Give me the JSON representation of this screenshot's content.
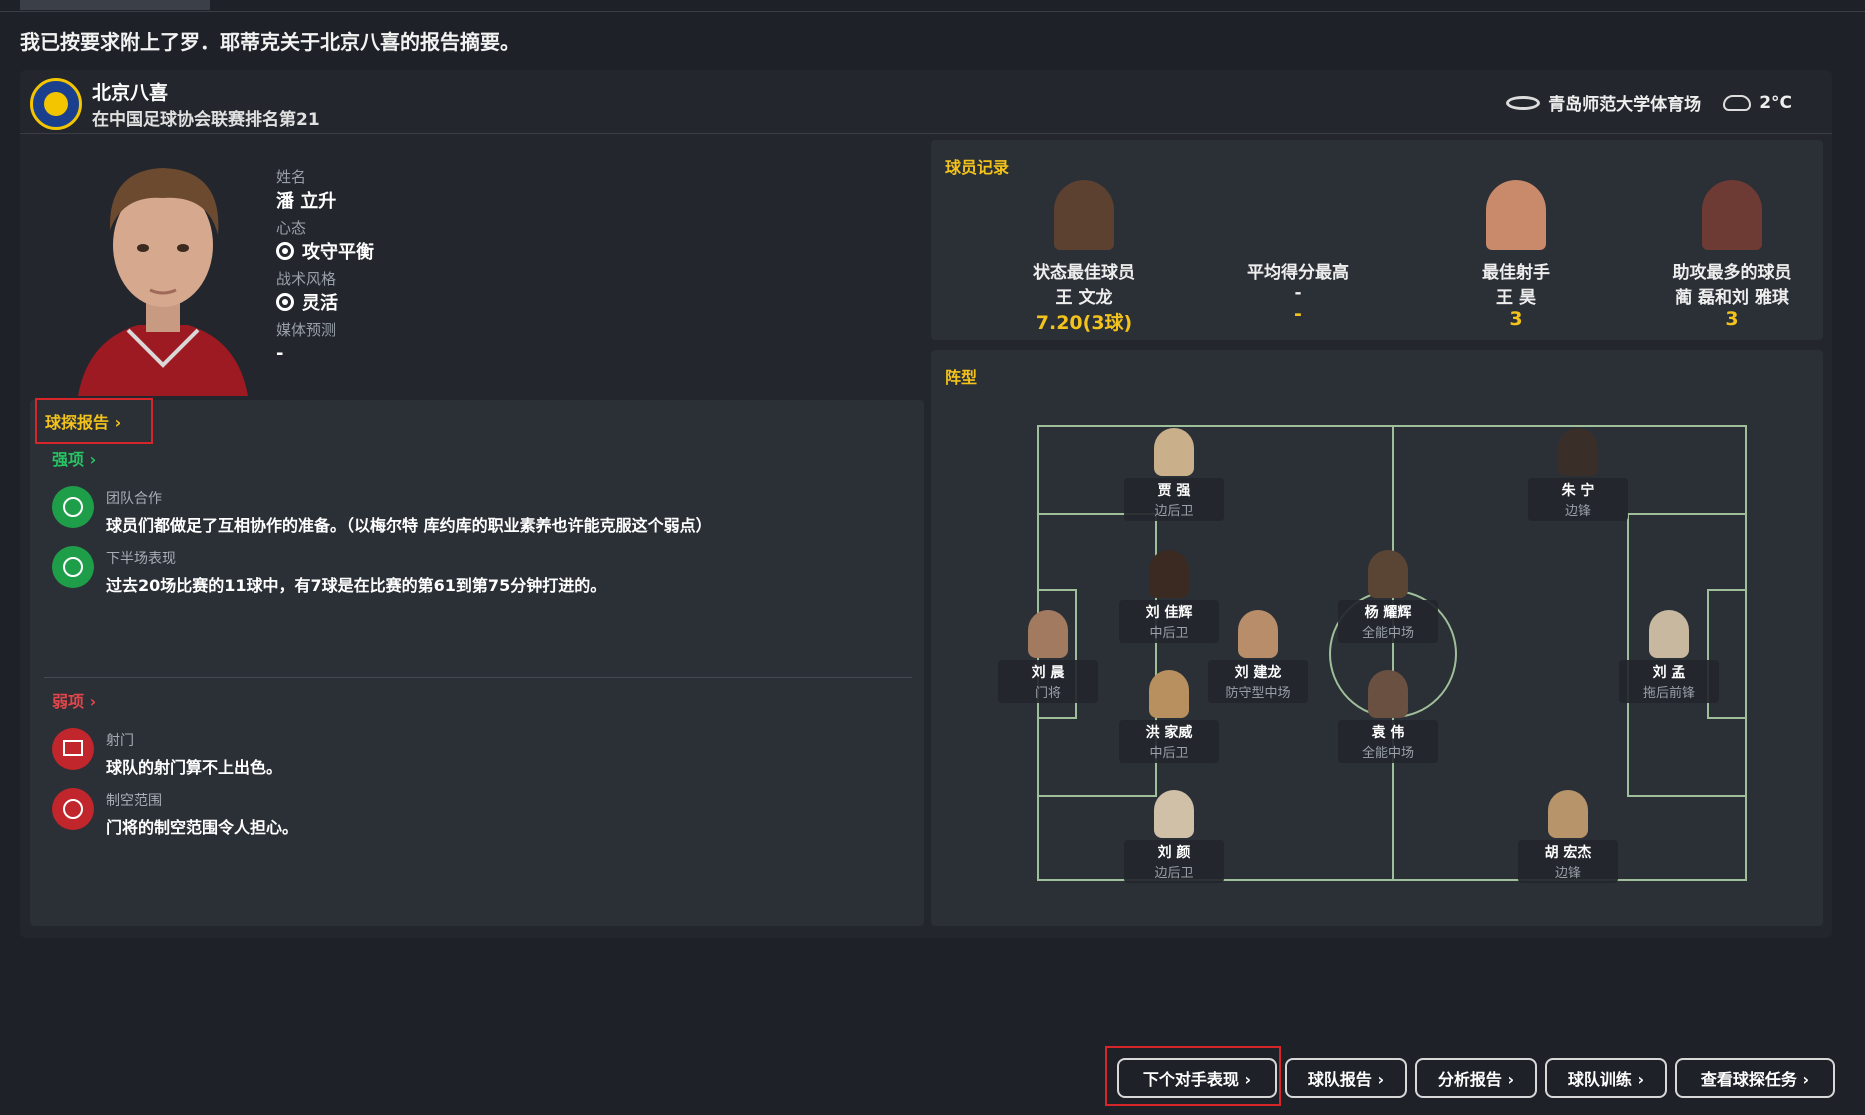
{
  "message": "我已按要求附上了罗．耶蒂克关于北京八喜的报告摘要。",
  "club": {
    "name": "北京八喜",
    "ranking": "在中国足球协会联赛排名第21",
    "venue": "青岛师范大学体育场",
    "temperature": "2°C"
  },
  "player": {
    "name_label": "姓名",
    "name": "潘 立升",
    "mentality_label": "心态",
    "mentality": "攻守平衡",
    "style_label": "战术风格",
    "style": "灵活",
    "media_label": "媒体预测",
    "media": "-"
  },
  "scout": {
    "tab_label": "球探报告 ›",
    "strengths_title": "强项 ›",
    "strengths": [
      {
        "title": "团队合作",
        "text": "球员们都做足了互相协作的准备。（以梅尔特 库约库的职业素养也许能克服这个弱点）"
      },
      {
        "title": "下半场表现",
        "text": "过去20场比赛的11球中，有7球是在比赛的第61到第75分钟打进的。"
      }
    ],
    "weaknesses_title": "弱项 ›",
    "weaknesses": [
      {
        "title": "射门",
        "text": "球队的射门算不上出色。"
      },
      {
        "title": "制空范围",
        "text": "门将的制空范围令人担心。"
      }
    ]
  },
  "records": {
    "title": "球员记录",
    "items": [
      {
        "label": "状态最佳球员",
        "name": "王 文龙",
        "value": "7.20(3球)"
      },
      {
        "label": "平均得分最高",
        "name": "-",
        "value": "-"
      },
      {
        "label": "最佳射手",
        "name": "王 昊",
        "value": "3"
      },
      {
        "label": "助攻最多的球员",
        "name": "蔺 磊和刘 雅琪",
        "value": "3"
      }
    ]
  },
  "formation": {
    "title": "阵型",
    "players": [
      {
        "name": "贾 强",
        "pos": "边后卫"
      },
      {
        "name": "朱 宁",
        "pos": "边锋"
      },
      {
        "name": "刘 佳辉",
        "pos": "中后卫"
      },
      {
        "name": "杨 耀辉",
        "pos": "全能中场"
      },
      {
        "name": "刘 晨",
        "pos": "门将"
      },
      {
        "name": "刘 建龙",
        "pos": "防守型中场"
      },
      {
        "name": "刘 孟",
        "pos": "拖后前锋"
      },
      {
        "name": "洪 家威",
        "pos": "中后卫"
      },
      {
        "name": "袁 伟",
        "pos": "全能中场"
      },
      {
        "name": "刘 颜",
        "pos": "边后卫"
      },
      {
        "name": "胡 宏杰",
        "pos": "边锋"
      }
    ]
  },
  "buttons": [
    "下个对手表现 ›",
    "球队报告 ›",
    "分析报告 ›",
    "球队训练 ›",
    "查看球探任务 ›"
  ],
  "colors": {
    "accent": "#f3c31b",
    "strength": "#27c463",
    "weakness": "#e0464a",
    "highlight": "#d7262a"
  }
}
